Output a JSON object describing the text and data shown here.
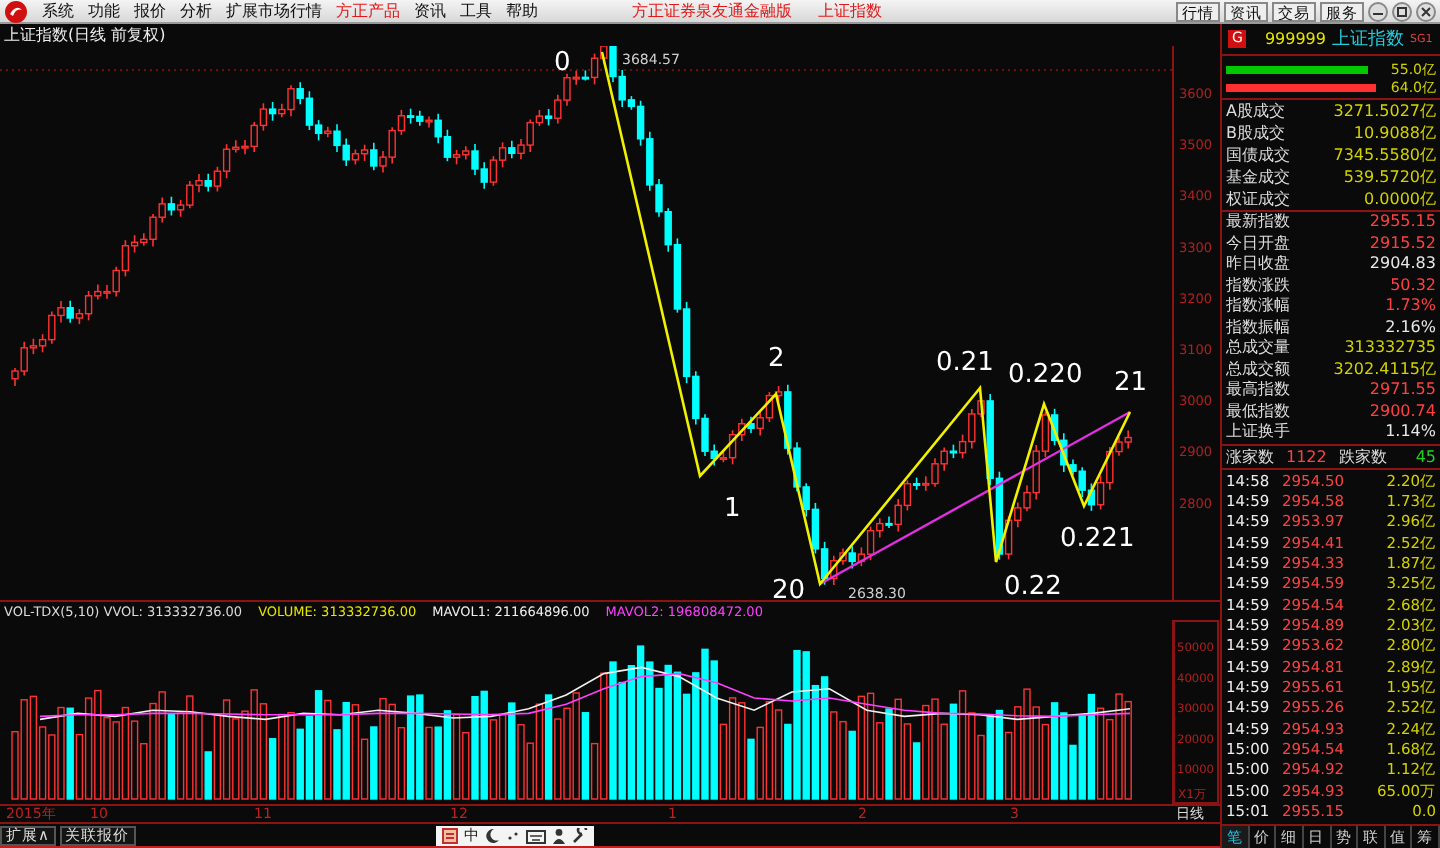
{
  "menu_bar": {
    "items": [
      {
        "label": "系统",
        "highlighted": false
      },
      {
        "label": "功能",
        "highlighted": false
      },
      {
        "label": "报价",
        "highlighted": false
      },
      {
        "label": "分析",
        "highlighted": false
      },
      {
        "label": "扩展市场行情",
        "highlighted": false
      },
      {
        "label": "方正产品",
        "highlighted": true
      },
      {
        "label": "资讯",
        "highlighted": false
      },
      {
        "label": "工具",
        "highlighted": false
      },
      {
        "label": "帮助",
        "highlighted": false
      }
    ],
    "center_title": "方正证券泉友通金融版",
    "center_subtitle": "上证指数",
    "buttons": [
      "行情",
      "资讯",
      "交易",
      "服务"
    ]
  },
  "chart": {
    "title": "上证指数(日线 前复权)",
    "price_axis": [
      "3600",
      "3500",
      "3400",
      "3300",
      "3200",
      "3100",
      "3000",
      "2900",
      "2800"
    ],
    "peak_label": "3684.57",
    "low_label": "2638.30",
    "wave_labels": [
      "0",
      "1",
      "2",
      "20",
      "0.21",
      "0.22",
      "0.220",
      "0.221",
      "21"
    ],
    "volume_legend": [
      {
        "text": "VOL-TDX(5,10) VVOL: 313332736.00",
        "color": "#dcdcdc"
      },
      {
        "text": "VOLUME: 313332736.00",
        "color": "#e6e600"
      }
    ],
    "average_readings": [
      ": 211664896.00",
      ": 196808472.00"
    ],
    "volume_unit": "X1万",
    "chart_data": {
      "type": "line",
      "ylim": [
        0,
        58500
      ],
      "yticks": [
        50000,
        40000,
        30000,
        20000,
        10000
      ],
      "series": [
        {
          "name": "MAVOL1",
          "color": "#f0f0f0",
          "values": [
            26000,
            28000,
            27000,
            29000,
            28500,
            27000,
            26000,
            28000,
            27500,
            29000,
            28000,
            26500,
            27000,
            29500,
            34000,
            41000,
            43000,
            40000,
            33000,
            29000,
            35000,
            36000,
            29000,
            27000,
            28000,
            27500,
            26000,
            27000,
            28000,
            29500
          ]
        },
        {
          "name": "MAVOL2",
          "color": "#ff40ff",
          "values": [
            27000,
            27500,
            27500,
            28000,
            28000,
            27800,
            27500,
            27500,
            27600,
            28000,
            28000,
            27800,
            27600,
            28000,
            31000,
            36000,
            40000,
            41000,
            38000,
            33000,
            32000,
            33000,
            31000,
            29000,
            28000,
            27800,
            27200,
            27000,
            27500,
            28000
          ]
        }
      ]
    },
    "date_axis": [
      "2015年",
      "10",
      "11",
      "12",
      "1",
      "2",
      "3"
    ],
    "period": "日线"
  },
  "quote_panel": {
    "badge": "G",
    "code": "999999",
    "name": "上证指数",
    "suffix": "SG1",
    "bars": [
      {
        "value": "55.0亿",
        "color": "#00c800",
        "level": 0.95
      },
      {
        "value": "64.0亿",
        "color": "#ff3030",
        "level": 1.0
      }
    ],
    "turnover": [
      {
        "label": "A股成交",
        "value": "3271.5027亿"
      },
      {
        "label": "B股成交",
        "value": "10.9088亿"
      },
      {
        "label": "国债成交",
        "value": "7345.5580亿"
      },
      {
        "label": "基金成交",
        "value": "539.5720亿"
      },
      {
        "label": "权证成交",
        "value": "0.0000亿"
      }
    ],
    "stats": [
      {
        "label": "最新指数",
        "value": "2955.15",
        "color": "#ff4040"
      },
      {
        "label": "今日开盘",
        "value": "2915.52",
        "color": "#ff4040"
      },
      {
        "label": "昨日收盘",
        "value": "2904.83",
        "color": "#e8e8e8"
      },
      {
        "label": "指数涨跌",
        "value": "50.32",
        "color": "#ff4040"
      },
      {
        "label": "指数涨幅",
        "value": "1.73%",
        "color": "#ff4040"
      },
      {
        "label": "指数振幅",
        "value": "2.16%",
        "color": "#e8e8e8"
      },
      {
        "label": "总成交量",
        "value": "313332735",
        "color": "#d2d200"
      },
      {
        "label": "总成交额",
        "value": "3202.4115亿",
        "color": "#d2d200"
      },
      {
        "label": "最高指数",
        "value": "2971.55",
        "color": "#ff4040"
      },
      {
        "label": "最低指数",
        "value": "2900.74",
        "color": "#ff4040"
      },
      {
        "label": "上证换手",
        "value": "1.14%",
        "color": "#e8e8e8"
      }
    ],
    "advancers_label": "涨家数",
    "advancers": "1122",
    "decliners_label": "跌家数",
    "decliners": "45",
    "ticks": [
      {
        "time": "14:58",
        "price": "2954.50",
        "volume": "2.20亿"
      },
      {
        "time": "14:59",
        "price": "2954.58",
        "volume": "1.73亿"
      },
      {
        "time": "14:59",
        "price": "2953.97",
        "volume": "2.96亿"
      },
      {
        "time": "14:59",
        "price": "2954.41",
        "volume": "2.52亿"
      },
      {
        "time": "14:59",
        "price": "2954.33",
        "volume": "1.87亿"
      },
      {
        "time": "14:59",
        "price": "2954.59",
        "volume": "3.25亿"
      },
      {
        "time": "14:59",
        "price": "2954.54",
        "volume": "2.68亿"
      },
      {
        "time": "14:59",
        "price": "2954.89",
        "volume": "2.03亿"
      },
      {
        "time": "14:59",
        "price": "2953.62",
        "volume": "2.80亿"
      },
      {
        "time": "14:59",
        "price": "2954.81",
        "volume": "2.89亿"
      },
      {
        "time": "14:59",
        "price": "2955.61",
        "volume": "1.95亿"
      },
      {
        "time": "14:59",
        "price": "2955.26",
        "volume": "2.52亿"
      },
      {
        "time": "14:59",
        "price": "2954.93",
        "volume": "2.24亿"
      },
      {
        "time": "15:00",
        "price": "2954.54",
        "volume": "1.68亿"
      },
      {
        "time": "15:00",
        "price": "2954.92",
        "volume": "1.12亿"
      },
      {
        "time": "15:00",
        "price": "2954.93",
        "volume": "65.00万"
      },
      {
        "time": "15:01",
        "price": "2955.15",
        "volume": "0.0"
      }
    ],
    "tabs": [
      {
        "label": "笔",
        "selected": true
      },
      {
        "label": "价",
        "selected": false
      },
      {
        "label": "细",
        "selected": false
      },
      {
        "label": "日",
        "selected": false
      },
      {
        "label": "势",
        "selected": false
      },
      {
        "label": "联",
        "selected": false
      },
      {
        "label": "值",
        "selected": false
      },
      {
        "label": "筹",
        "selected": false
      }
    ]
  },
  "bottom_bar": {
    "tabs": [
      "扩展∧",
      "关联报价"
    ],
    "ime_label": "中"
  }
}
